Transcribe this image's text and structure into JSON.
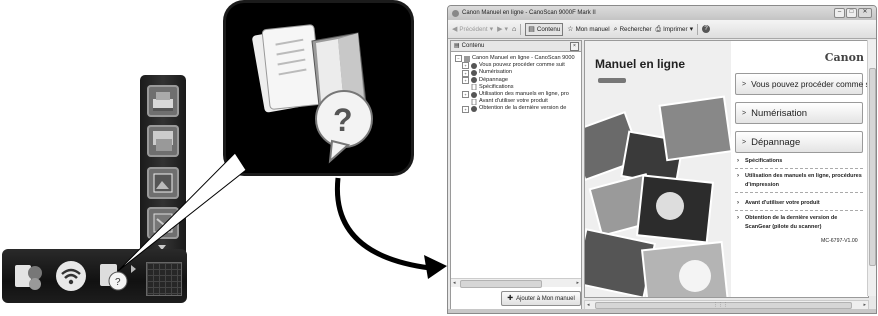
{
  "window": {
    "title": "Canon Manuel en ligne - CanoScan 9000F Mark II",
    "controls": {
      "minimize": "–",
      "maximize": "□",
      "close": "✕"
    }
  },
  "toolbar": {
    "back_label": "Précédent",
    "contents_label": "Contenu",
    "my_manual_label": "Mon manuel",
    "search_label": "Rechercher",
    "print_label": "Imprimer"
  },
  "sidebar": {
    "header": "Contenu",
    "close": "×",
    "items": [
      {
        "label": "Canon Manuel en ligne - CanoScan 9000",
        "level": 0
      },
      {
        "label": "Vous pouvez procéder comme suit",
        "level": 1
      },
      {
        "label": "Numérisation",
        "level": 1
      },
      {
        "label": "Dépannage",
        "level": 1
      },
      {
        "label": "Spécifications",
        "level": 1
      },
      {
        "label": "Utilisation des manuels en ligne, pro",
        "level": 1
      },
      {
        "label": "Avant d'utiliser votre produit",
        "level": 1
      },
      {
        "label": "Obtention de la dernière version de",
        "level": 1
      }
    ],
    "add_button_prefix": "",
    "add_button_label": "Ajouter à Mon manuel"
  },
  "main": {
    "manual_title": "Manuel en ligne",
    "brand": "Canon",
    "buttons": [
      "Vous pouvez procéder comme suit",
      "Numérisation",
      "Dépannage"
    ],
    "links": [
      "Spécifications",
      "Utilisation des manuels en ligne, procédures d'impression",
      "Avant d'utiliser votre produit",
      "Obtention de la dernière version de ScanGear (pilote du scanner)"
    ],
    "doc_code": "MC-6797-V1.00"
  },
  "colors": {
    "window_bg": "#e8e8e8",
    "panel_bg": "#ffffff",
    "dock_bg": "#1a1a1a"
  }
}
